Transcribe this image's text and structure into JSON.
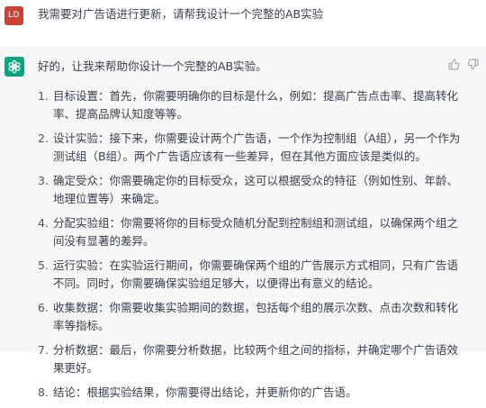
{
  "user_message": {
    "avatar_initials": "LD",
    "text": "我需要对广告语进行更新，请帮我设计一个完整的AB实验"
  },
  "assistant_message": {
    "intro": "好的，让我来帮助你设计一个完整的AB实验。",
    "steps": [
      {
        "num": "1.",
        "text": "目标设置：首先，你需要明确你的目标是什么，例如：提高广告点击率、提高转化率、提高品牌认知度等等。"
      },
      {
        "num": "2.",
        "text": "设计实验：接下来，你需要设计两个广告语，一个作为控制组（A组），另一个作为测试组（B组）。两个广告语应该有一些差异，但在其他方面应该是类似的。"
      },
      {
        "num": "3.",
        "text": "确定受众：你需要确定你的目标受众，这可以根据受众的特征（例如性别、年龄、地理位置等）来确定。"
      },
      {
        "num": "4.",
        "text": "分配实验组：你需要将你的目标受众随机分配到控制组和测试组，以确保两个组之间没有显著的差异。"
      },
      {
        "num": "5.",
        "text": "运行实验：在实验运行期间，你需要确保两个组的广告展示方式相同，只有广告语不同。同时，你需要确保实验组足够大，以便得出有意义的结论。"
      },
      {
        "num": "6.",
        "text": "收集数据：你需要收集实验期间的数据，包括每个组的展示次数、点击次数和转化率等指标。"
      },
      {
        "num": "7.",
        "text": "分析数据：最后，你需要分析数据，比较两个组之间的指标，并确定哪个广告语效果更好。"
      },
      {
        "num": "8.",
        "text": "结论：根据实验结果，你需要得出结论，并更新你的广告语。"
      }
    ]
  },
  "colors": {
    "user_avatar": "#c94436",
    "assistant_avatar": "#10a37f",
    "assistant_bg": "#f7f7f8",
    "text": "#374151"
  },
  "icons": [
    "openai-logo-icon",
    "thumbs-up-icon",
    "thumbs-down-icon"
  ]
}
